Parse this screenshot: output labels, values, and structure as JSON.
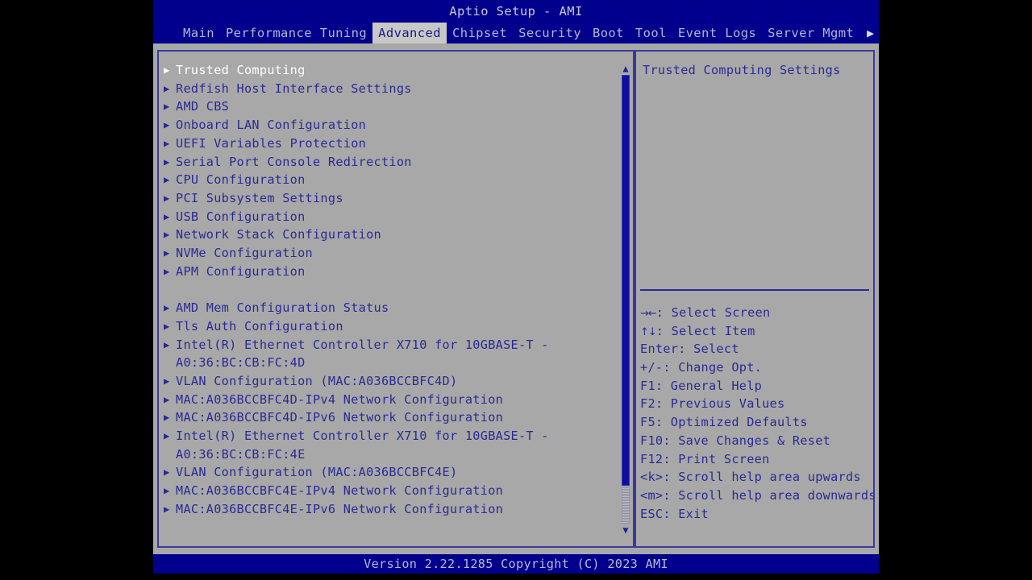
{
  "window": {
    "title": "Aptio Setup - AMI",
    "footer": "Version 2.22.1285 Copyright (C) 2023 AMI"
  },
  "colors": {
    "header_bg": "#00008c",
    "panel_bg": "#a8a8a8",
    "text": "#2a2a96",
    "selected_text": "#ffffff",
    "active_tab_bg": "#c8c8c8"
  },
  "tabs": [
    {
      "label": "Main",
      "active": false
    },
    {
      "label": "Performance Tuning",
      "active": false
    },
    {
      "label": "Advanced",
      "active": true
    },
    {
      "label": "Chipset",
      "active": false
    },
    {
      "label": "Security",
      "active": false
    },
    {
      "label": "Boot",
      "active": false
    },
    {
      "label": "Tool",
      "active": false
    },
    {
      "label": "Event Logs",
      "active": false
    },
    {
      "label": "Server Mgmt",
      "active": false
    }
  ],
  "tab_overflow_icon": "▶",
  "menu": {
    "items": [
      {
        "label": "Trusted Computing",
        "selected": true,
        "arrow": true,
        "blank": false
      },
      {
        "label": "Redfish Host Interface Settings",
        "selected": false,
        "arrow": true,
        "blank": false
      },
      {
        "label": "AMD CBS",
        "selected": false,
        "arrow": true,
        "blank": false
      },
      {
        "label": "Onboard LAN Configuration",
        "selected": false,
        "arrow": true,
        "blank": false
      },
      {
        "label": "UEFI Variables Protection",
        "selected": false,
        "arrow": true,
        "blank": false
      },
      {
        "label": "Serial Port Console Redirection",
        "selected": false,
        "arrow": true,
        "blank": false
      },
      {
        "label": "CPU Configuration",
        "selected": false,
        "arrow": true,
        "blank": false
      },
      {
        "label": "PCI Subsystem Settings",
        "selected": false,
        "arrow": true,
        "blank": false
      },
      {
        "label": "USB Configuration",
        "selected": false,
        "arrow": true,
        "blank": false
      },
      {
        "label": "Network Stack Configuration",
        "selected": false,
        "arrow": true,
        "blank": false
      },
      {
        "label": "NVMe Configuration",
        "selected": false,
        "arrow": true,
        "blank": false
      },
      {
        "label": "APM Configuration",
        "selected": false,
        "arrow": true,
        "blank": false
      },
      {
        "label": "",
        "selected": false,
        "arrow": false,
        "blank": true
      },
      {
        "label": "AMD Mem Configuration Status",
        "selected": false,
        "arrow": true,
        "blank": false
      },
      {
        "label": "Tls Auth Configuration",
        "selected": false,
        "arrow": true,
        "blank": false
      },
      {
        "label": "Intel(R) Ethernet Controller X710 for 10GBASE-T -",
        "selected": false,
        "arrow": true,
        "blank": false
      },
      {
        "label": "A0:36:BC:CB:FC:4D",
        "selected": false,
        "arrow": false,
        "blank": false
      },
      {
        "label": "VLAN Configuration (MAC:A036BCCBFC4D)",
        "selected": false,
        "arrow": true,
        "blank": false
      },
      {
        "label": "MAC:A036BCCBFC4D-IPv4 Network Configuration",
        "selected": false,
        "arrow": true,
        "blank": false
      },
      {
        "label": "MAC:A036BCCBFC4D-IPv6 Network Configuration",
        "selected": false,
        "arrow": true,
        "blank": false
      },
      {
        "label": "Intel(R) Ethernet Controller X710 for 10GBASE-T -",
        "selected": false,
        "arrow": true,
        "blank": false
      },
      {
        "label": "A0:36:BC:CB:FC:4E",
        "selected": false,
        "arrow": false,
        "blank": false
      },
      {
        "label": "VLAN Configuration (MAC:A036BCCBFC4E)",
        "selected": false,
        "arrow": true,
        "blank": false
      },
      {
        "label": "MAC:A036BCCBFC4E-IPv4 Network Configuration",
        "selected": false,
        "arrow": true,
        "blank": false
      },
      {
        "label": "MAC:A036BCCBFC4E-IPv6 Network Configuration",
        "selected": false,
        "arrow": true,
        "blank": false
      }
    ],
    "item_arrow_icon": "▶"
  },
  "scrollbar": {
    "up_arrow_icon": "▲",
    "down_arrow_icon": "▼"
  },
  "help": {
    "title": "Trusted Computing Settings",
    "keys": [
      {
        "glyph": "→←",
        "text": ": Select Screen"
      },
      {
        "glyph": "↑↓",
        "text": ": Select Item"
      },
      {
        "glyph": "",
        "text": "Enter: Select"
      },
      {
        "glyph": "",
        "text": "+/-: Change Opt."
      },
      {
        "glyph": "",
        "text": "F1: General Help"
      },
      {
        "glyph": "",
        "text": "F2: Previous Values"
      },
      {
        "glyph": "",
        "text": "F5: Optimized Defaults"
      },
      {
        "glyph": "",
        "text": "F10: Save Changes & Reset"
      },
      {
        "glyph": "",
        "text": "F12: Print Screen"
      },
      {
        "glyph": "",
        "text": "<k>: Scroll help area upwards"
      },
      {
        "glyph": "",
        "text": "<m>: Scroll help area downwards"
      },
      {
        "glyph": "",
        "text": "ESC: Exit"
      }
    ]
  }
}
